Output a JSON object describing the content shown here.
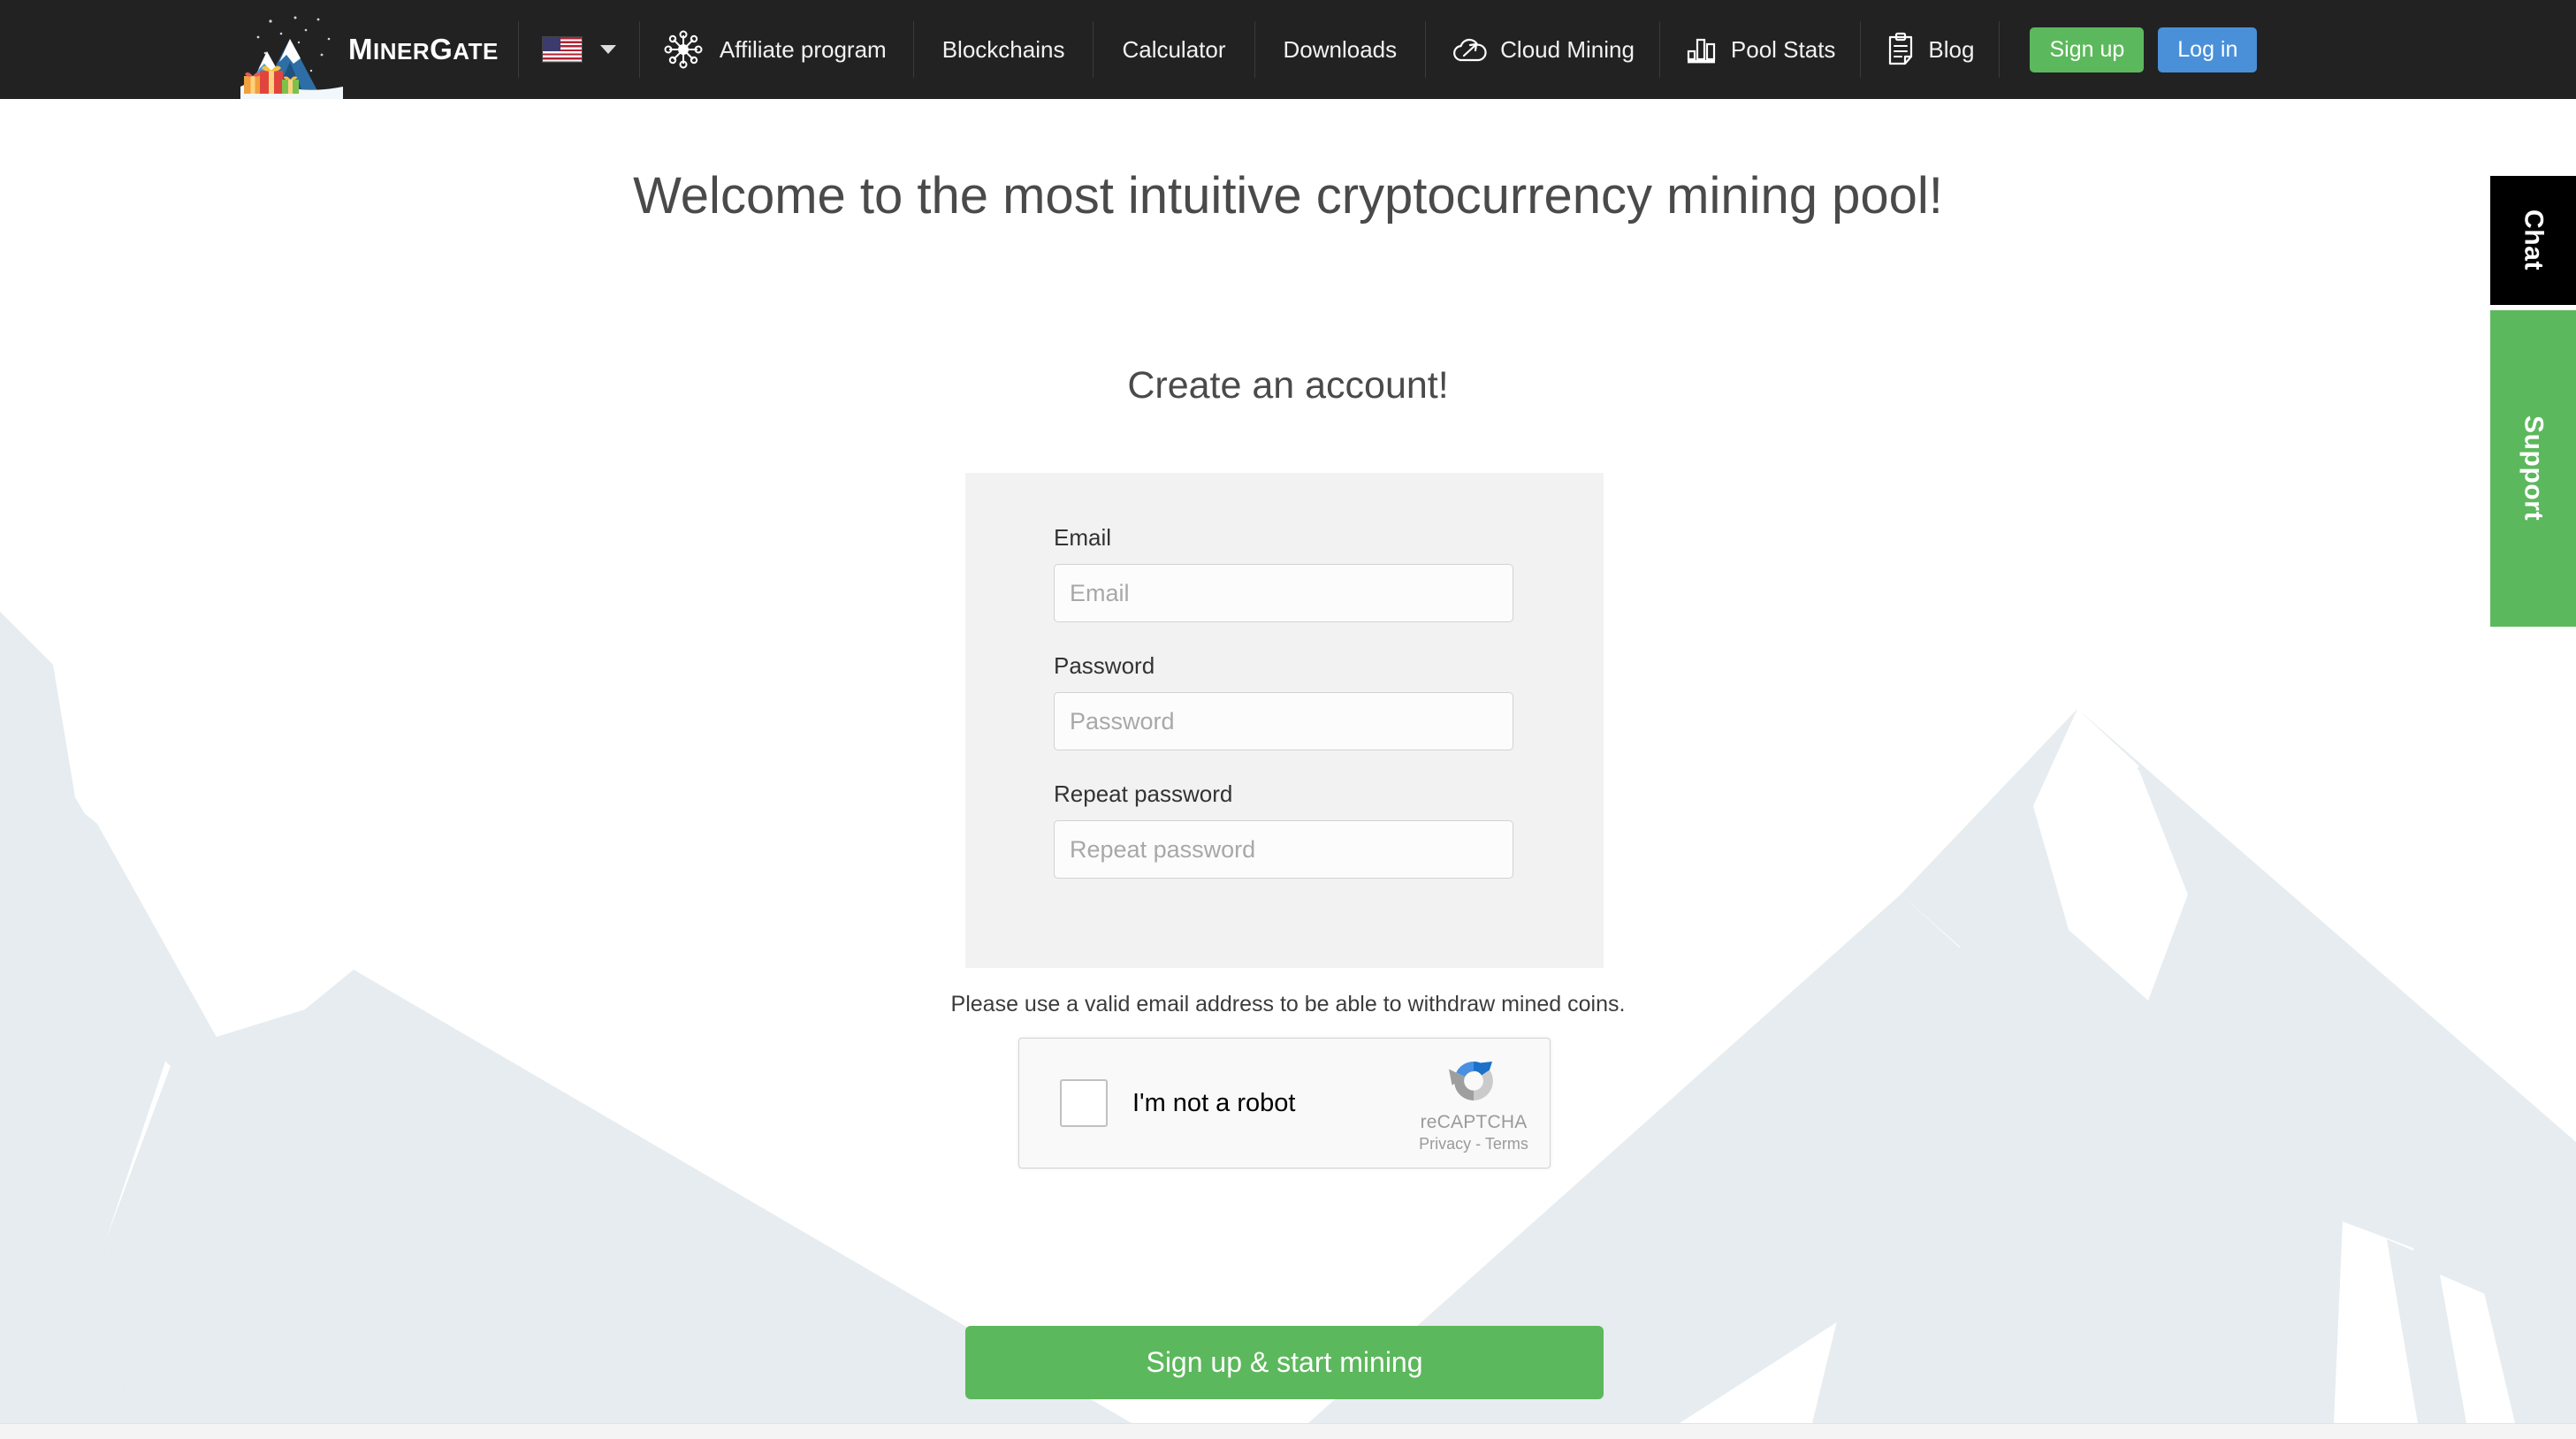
{
  "navbar": {
    "brand": {
      "name_cap1": "M",
      "name_rest1": "INER",
      "name_cap2": "G",
      "name_rest2": "ATE",
      "logo_icon": "minergate-mountain-logo"
    },
    "language": {
      "flag": "us-flag-icon",
      "caret": "chevron-down-icon"
    },
    "affiliate": {
      "label": "Affiliate program",
      "icon": "network-hub-icon"
    },
    "links": [
      {
        "label": "Blockchains",
        "icon": null
      },
      {
        "label": "Calculator",
        "icon": null
      },
      {
        "label": "Downloads",
        "icon": null
      },
      {
        "label": "Cloud Mining",
        "icon": "cloud-pickaxe-icon"
      },
      {
        "label": "Pool Stats",
        "icon": "bar-chart-icon"
      },
      {
        "label": "Blog",
        "icon": "clipboard-document-icon"
      }
    ],
    "buttons": {
      "signup": "Sign up",
      "login": "Log in"
    },
    "colors": {
      "background": "#222222",
      "signup_green": "#5cb85c",
      "login_blue": "#4a90d9"
    }
  },
  "main": {
    "headline": "Welcome to the most intuitive cryptocurrency mining pool!",
    "subhead": "Create an account!",
    "form": {
      "fields": [
        {
          "label": "Email",
          "placeholder": "Email",
          "value": "",
          "type": "text",
          "name": "email-field"
        },
        {
          "label": "Password",
          "placeholder": "Password",
          "value": "",
          "type": "password",
          "name": "password-field"
        },
        {
          "label": "Repeat password",
          "placeholder": "Repeat password",
          "value": "",
          "type": "password",
          "name": "repeat-password-field"
        }
      ],
      "helper_text": "Please use a valid email address to be able to withdraw mined coins.",
      "submit_label": "Sign up & start mining"
    },
    "recaptcha": {
      "checkbox_label": "I'm not a robot",
      "brand_name": "reCAPTCHA",
      "terms": "Privacy - Terms",
      "logo_icon": "recaptcha-arrows-icon"
    }
  },
  "side_tabs": [
    {
      "label": "Chat",
      "color": "#000000"
    },
    {
      "label": "Support",
      "color": "#5cb85c"
    }
  ],
  "background": {
    "mountain_color": "#e6ecef",
    "page_color": "#ffffff",
    "footer_color": "#f4f4f4"
  }
}
